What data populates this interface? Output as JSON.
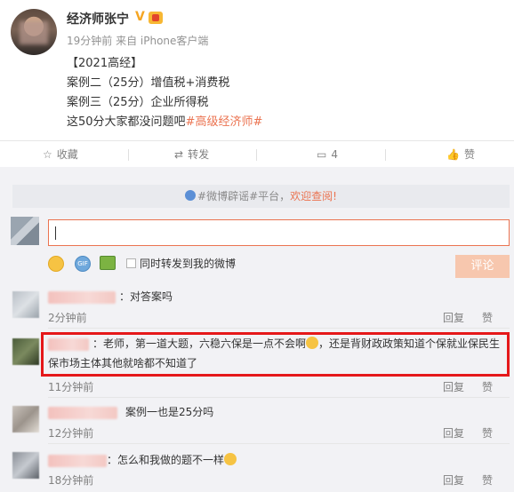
{
  "post": {
    "author": "经济师张宁",
    "verified_mark": "V",
    "meta": "19分钟前 来自 iPhone客户端",
    "lines": [
      "【2021高经】",
      "案例二（25分）增值税+消费税",
      "案例三（25分）企业所得税"
    ],
    "last_line_prefix": "这50分大家都没问题吧",
    "hashtag": "#高级经济师#"
  },
  "actions": {
    "favorite": "收藏",
    "repost": "转发",
    "comment_count": "4",
    "like": "赞"
  },
  "notice": {
    "prefix": "#微博辟谣#平台，",
    "link": "欢迎查阅!"
  },
  "compose": {
    "sync_label": "同时转发到我的微博",
    "submit": "评论"
  },
  "comments": [
    {
      "text": "：对答案吗",
      "time": "2分钟前",
      "reply": "回复",
      "like": "赞"
    },
    {
      "text_line1": "：老师，第一道大题，六稳六保是一点不会啊",
      "text_line1_b": "，还是背财政政策知道个保就业保民生",
      "text_line2": "保市场主体其他就啥都不知道了",
      "time": "11分钟前",
      "reply": "回复",
      "like": "赞"
    },
    {
      "text": "案例一也是25分吗",
      "time": "12分钟前",
      "reply": "回复",
      "like": "赞"
    },
    {
      "text": "：怎么和我做的题不一样",
      "time": "18分钟前",
      "reply": "回复",
      "like": "赞"
    }
  ],
  "colors": {
    "accent": "#eb7350",
    "highlight_box": "#e5181a"
  }
}
